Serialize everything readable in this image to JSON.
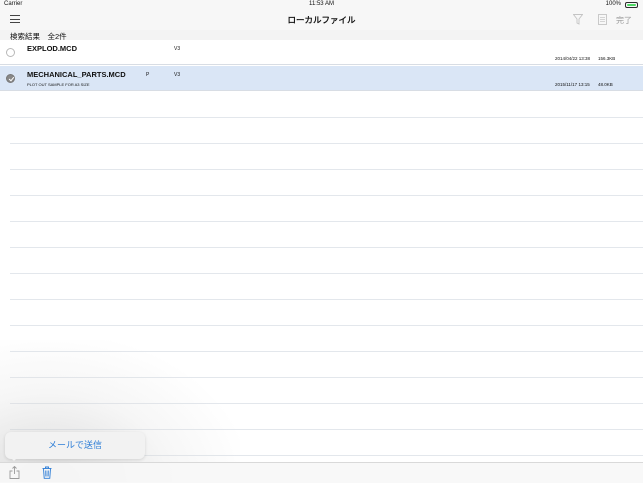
{
  "status_bar": {
    "carrier": "Carrier",
    "time": "11:53 AM",
    "battery": "100%",
    "battery_level": 1.0
  },
  "nav": {
    "title": "ローカルファイル",
    "done_label": "完了",
    "icons": [
      "menu-icon",
      "filter-icon",
      "document-icon"
    ]
  },
  "section": {
    "header": "検索結果　全2件"
  },
  "files": [
    {
      "name": "EXPLOD.MCD",
      "flag": "",
      "version": "V3",
      "description": "",
      "date": "2014/04/22 13:38",
      "size": "156.3KB",
      "selected": false
    },
    {
      "name": "MECHANICAL_PARTS.MCD",
      "flag": "P",
      "version": "V3",
      "description": "PLOT OUT SAMPLE FOR A3 SIZE",
      "date": "2015/11/17 13:15",
      "size": "48.0KB",
      "selected": true
    }
  ],
  "popup": {
    "send_mail_label": "メールで送信"
  },
  "toolbar": {
    "icons": [
      "share-icon",
      "trash-icon"
    ]
  },
  "colors": {
    "accent": "#2b7cd6",
    "selected_row": "#dae6f6",
    "battery": "#4cd964"
  }
}
